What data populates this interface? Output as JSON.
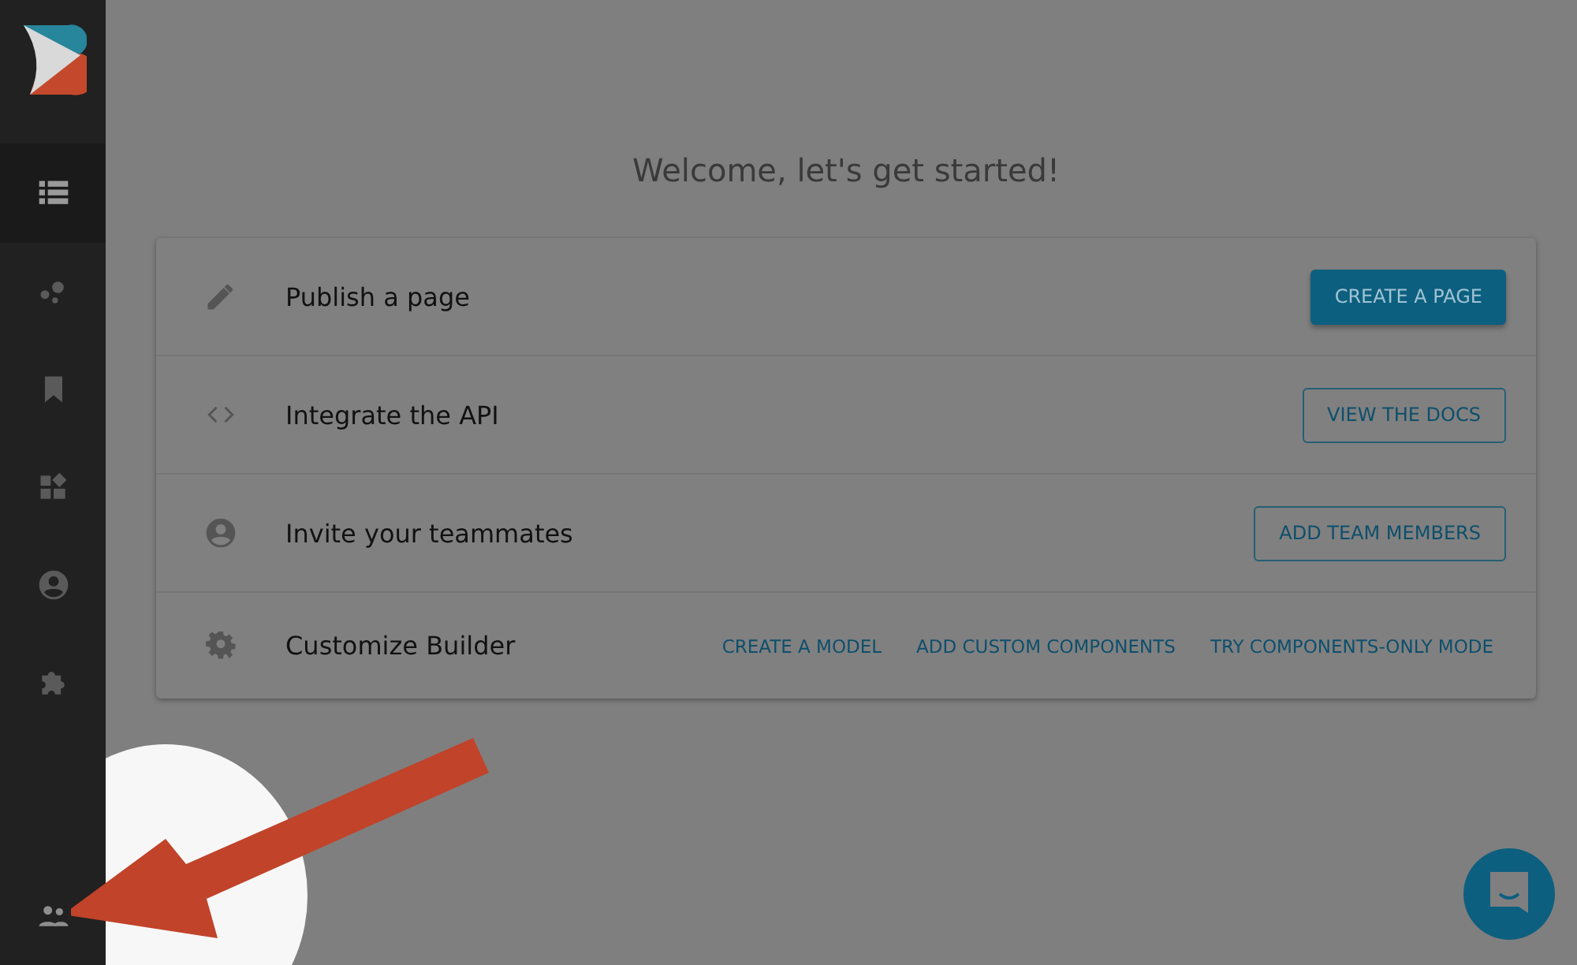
{
  "sidebar": {
    "items": [
      {
        "selected": true
      },
      {
        "selected": false
      },
      {
        "selected": false
      },
      {
        "selected": false
      },
      {
        "selected": false
      },
      {
        "selected": false
      },
      {
        "selected": false
      }
    ]
  },
  "heading": "Welcome, let's get started!",
  "steps": [
    {
      "kind": "button",
      "label": "Publish a page",
      "buttons": [
        {
          "label": "CREATE A PAGE",
          "kind": "primary"
        }
      ]
    },
    {
      "kind": "button",
      "label": "Integrate the API",
      "buttons": [
        {
          "label": "VIEW THE DOCS",
          "kind": "outlined"
        }
      ]
    },
    {
      "kind": "button",
      "label": "Invite your teammates",
      "buttons": [
        {
          "label": "ADD TEAM MEMBERS",
          "kind": "outlined"
        }
      ]
    },
    {
      "kind": "links",
      "label": "Customize Builder",
      "buttons": [
        {
          "label": "CREATE A MODEL",
          "kind": "text"
        },
        {
          "label": "ADD CUSTOM COMPONENTS",
          "kind": "text"
        },
        {
          "label": "TRY COMPONENTS-ONLY MODE",
          "kind": "text"
        }
      ]
    }
  ]
}
